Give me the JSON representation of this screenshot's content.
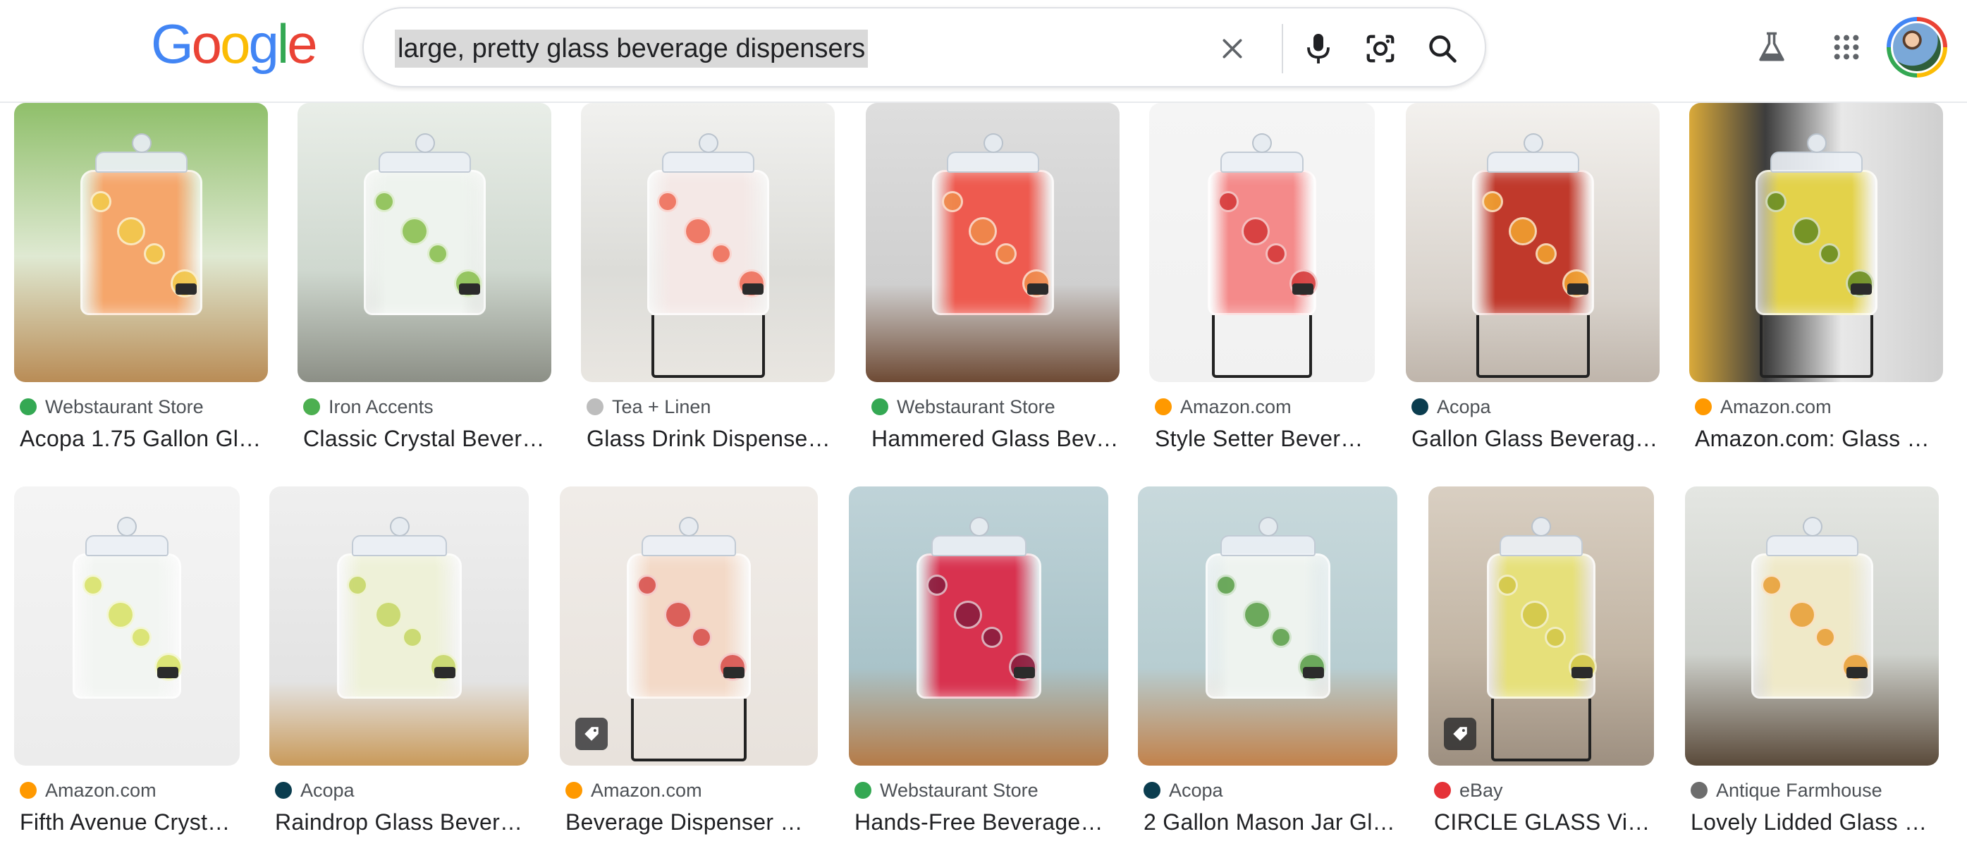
{
  "header": {
    "logo_text": "Google",
    "logo_colors": [
      "#4285f4",
      "#ea4335",
      "#fbbc05",
      "#4285f4",
      "#34a853",
      "#ea4335"
    ],
    "search_query": "large, pretty glass beverage dispensers",
    "icons": [
      "close-icon",
      "microphone-icon",
      "camera-search-icon",
      "search-icon",
      "labs-flask-icon",
      "apps-grid-icon",
      "profile-avatar"
    ]
  },
  "results": [
    {
      "source": "Webstaurant Store",
      "title": "Acopa 1.75 Gallon Gl…",
      "favicon_color": "#34a853",
      "favicon": "webstaurant-icon"
    },
    {
      "source": "Iron Accents",
      "title": "Classic Crystal Bever…",
      "favicon_color": "#4caf50",
      "favicon": "iron-accents-icon"
    },
    {
      "source": "Tea + Linen",
      "title": "Glass Drink Dispense…",
      "favicon_color": "#bdbdbd",
      "favicon": "tea-linen-icon"
    },
    {
      "source": "Webstaurant Store",
      "title": "Hammered Glass Bev…",
      "favicon_color": "#34a853",
      "favicon": "webstaurant-icon"
    },
    {
      "source": "Amazon.com",
      "title": "Style Setter Bever…",
      "favicon_color": "#ff9900",
      "favicon": "amazon-icon"
    },
    {
      "source": "Acopa",
      "title": "Gallon Glass Beverag…",
      "favicon_color": "#0b3d4f",
      "favicon": "acopa-icon"
    },
    {
      "source": "Amazon.com",
      "title": "Amazon.com: Glass …",
      "favicon_color": "#ff9900",
      "favicon": "amazon-icon"
    },
    {
      "source": "Amazon.com",
      "title": "Fifth Avenue Cryst…",
      "favicon_color": "#ff9900",
      "favicon": "amazon-icon"
    },
    {
      "source": "Acopa",
      "title": "Raindrop Glass Bever…",
      "favicon_color": "#0b3d4f",
      "favicon": "acopa-icon"
    },
    {
      "source": "Amazon.com",
      "title": "Beverage Dispenser …",
      "favicon_color": "#ff9900",
      "favicon": "amazon-icon"
    },
    {
      "source": "Webstaurant Store",
      "title": "Hands-Free Beverage…",
      "favicon_color": "#34a853",
      "favicon": "webstaurant-icon"
    },
    {
      "source": "Acopa",
      "title": "2 Gallon Mason Jar Gl…",
      "favicon_color": "#0b3d4f",
      "favicon": "acopa-icon"
    },
    {
      "source": "eBay",
      "title": "CIRCLE GLASS Vi…",
      "favicon_color": "#e53238",
      "favicon": "ebay-icon"
    },
    {
      "source": "Antique Farmhouse",
      "title": "Lovely Lidded Glass B…",
      "favicon_color": "#6d6d6d",
      "favicon": "antique-farmhouse-icon"
    }
  ]
}
